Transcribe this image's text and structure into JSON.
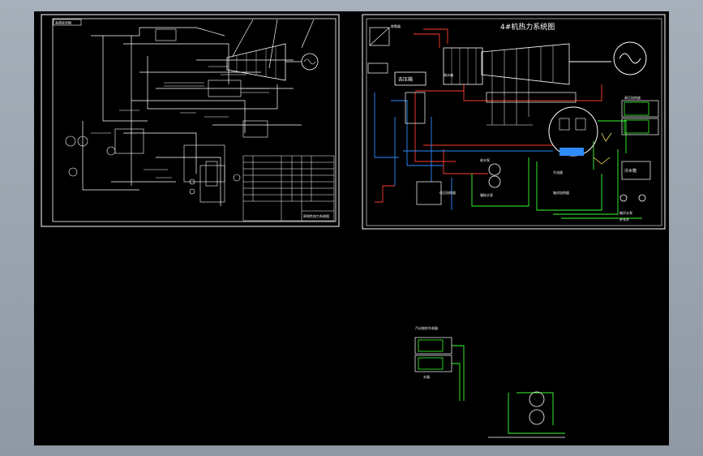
{
  "sheet_left": {
    "stamp": "系统综合图",
    "title_block_title": "原则性热力系统图"
  },
  "sheet_right": {
    "title": "4#机热力系统图",
    "labels": {
      "boiler_drum": "除氧器",
      "deaerator": "去压箱",
      "hp_heater": "高压加热器",
      "lp_heater": "低压加热器",
      "feed_pump": "给水泵",
      "cond_pump": "凝结水泵",
      "condenser": "冷水箱",
      "circ_water": "循环水泵",
      "makeup": "补充水",
      "gland": "轴封加热器",
      "cooler": "冷油器",
      "drain": "疏水箱"
    }
  },
  "fragment": {
    "label_top": "汽水取样冷却器",
    "label_mid": "水器"
  },
  "colors": {
    "background": "#000000",
    "line": "#ffffff",
    "steam": "#ff3b2f",
    "feedwater": "#2f8cff",
    "cooling": "#39ff2f",
    "signal": "#ffe65a"
  }
}
